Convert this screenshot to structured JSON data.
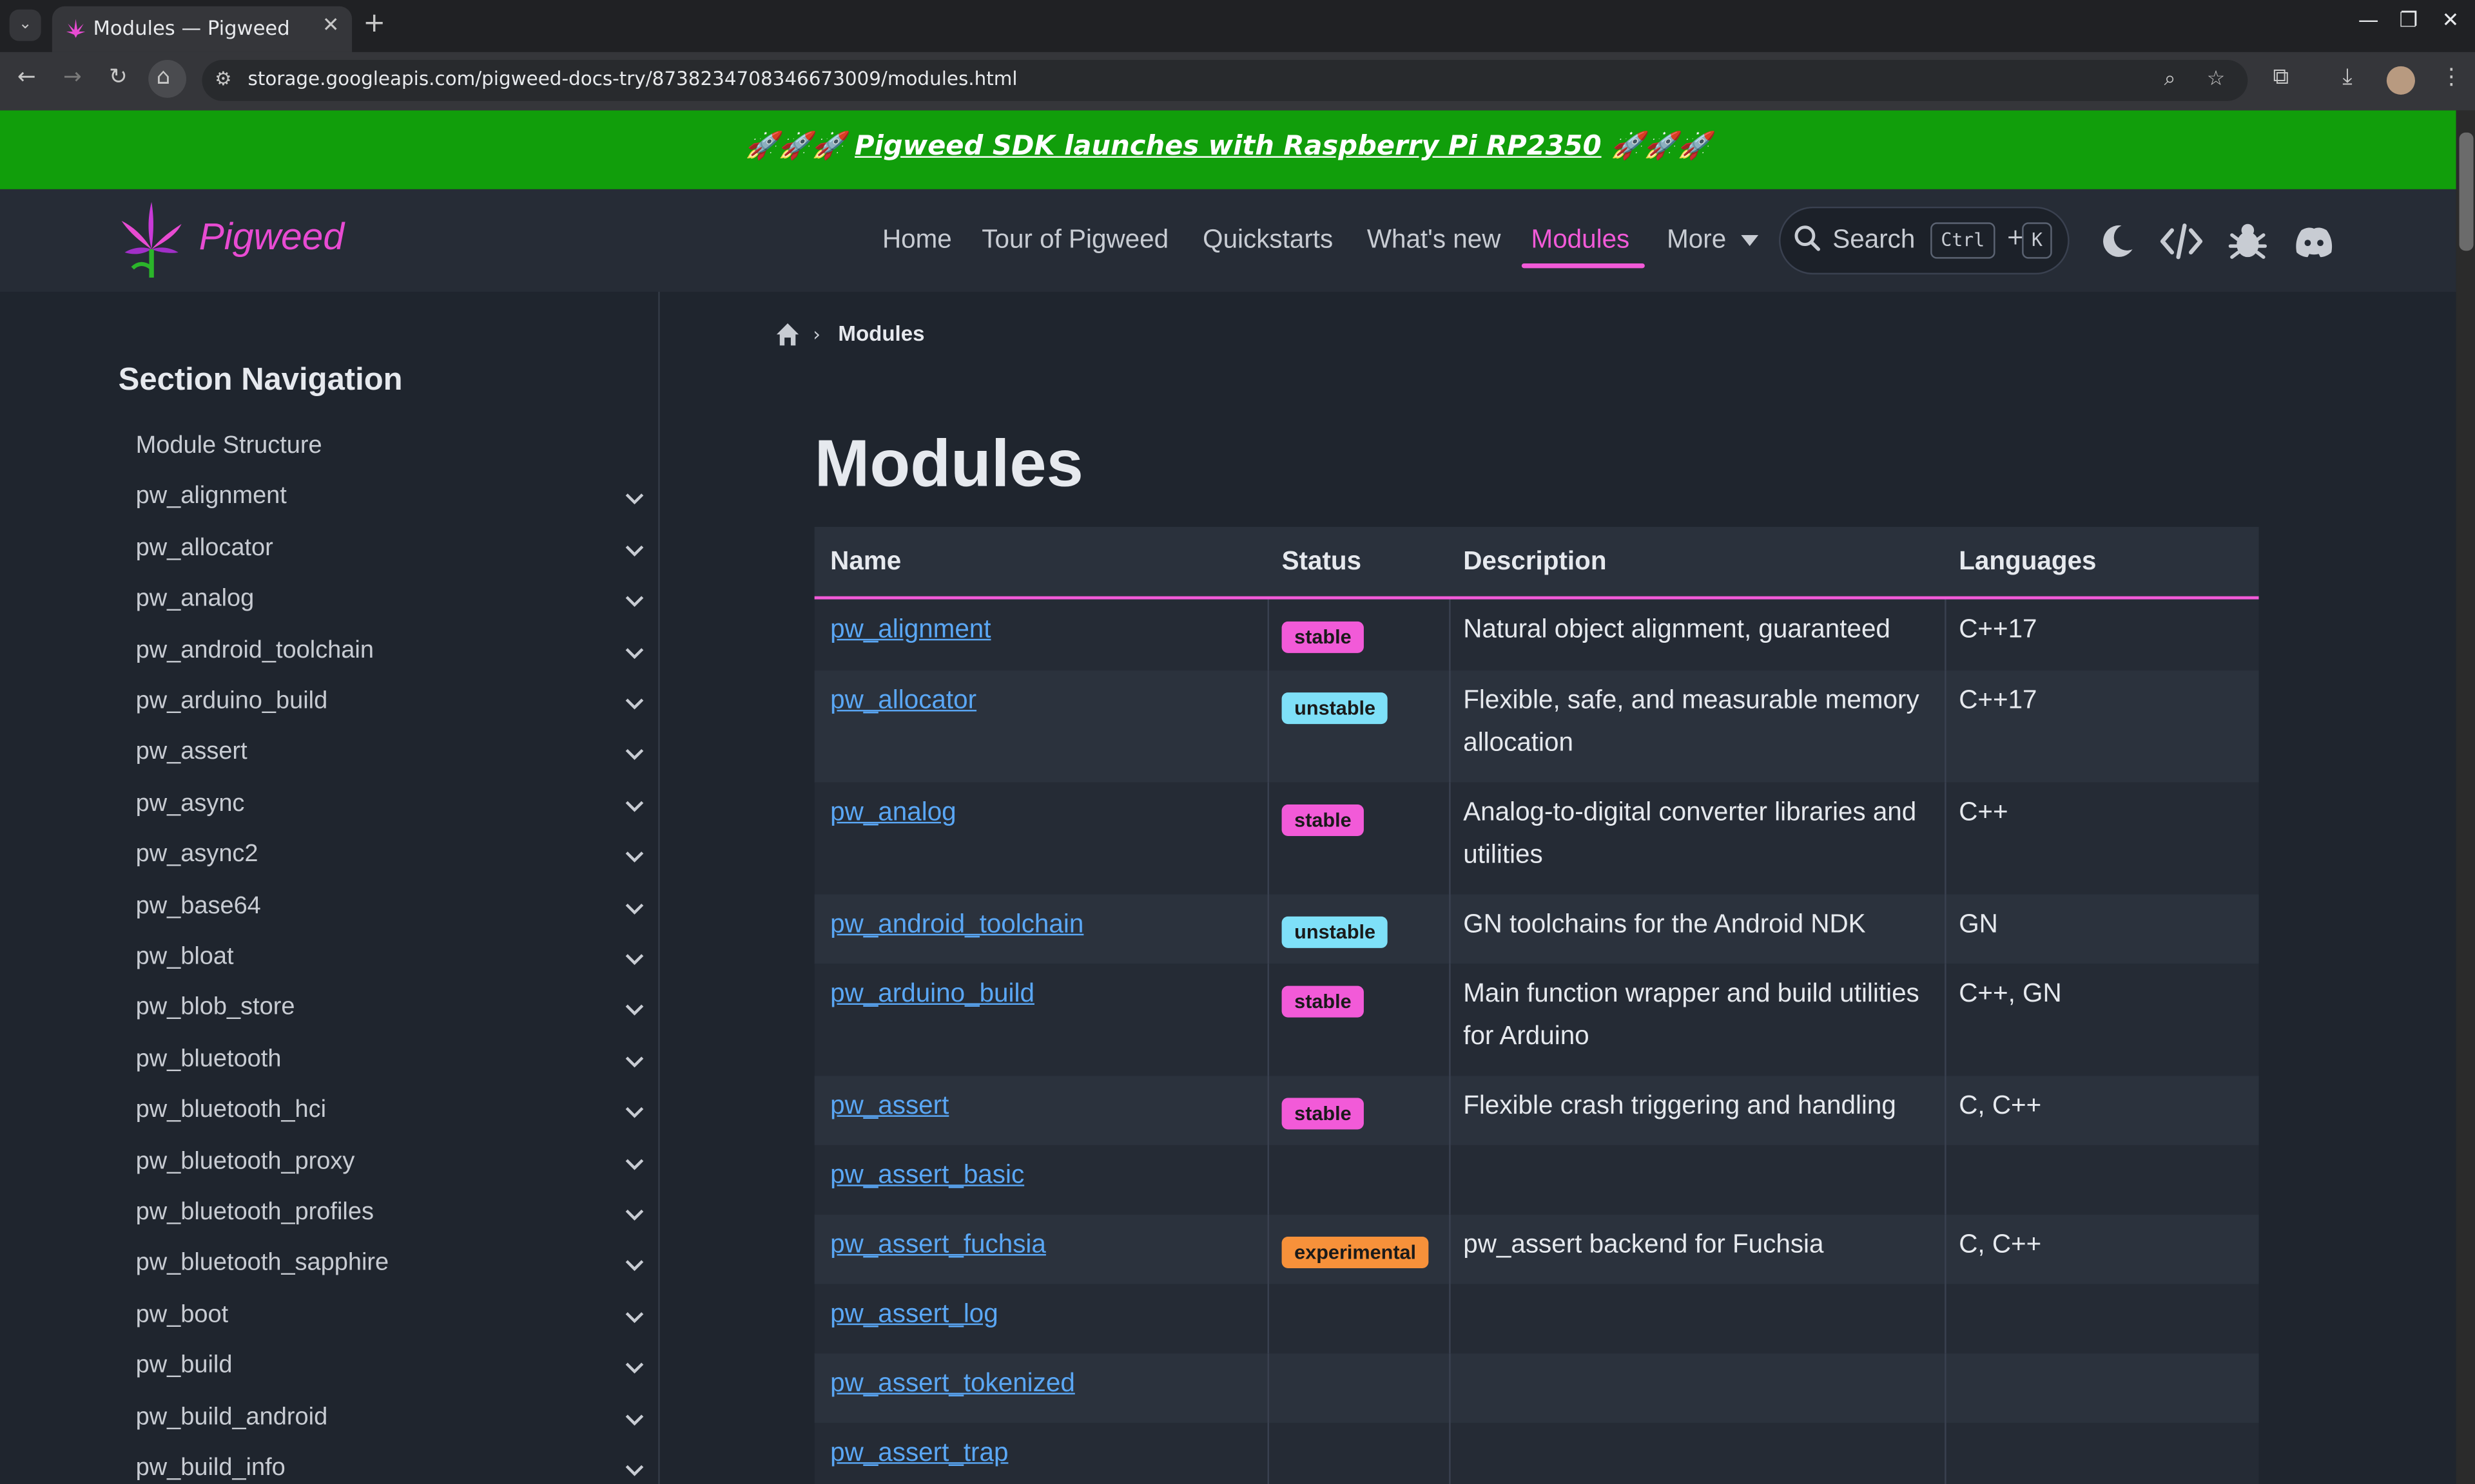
{
  "browser": {
    "tab_title": "Modules — Pigweed",
    "url": "storage.googleapis.com/pigweed-docs-try/8738234708346673009/modules.html",
    "tab_close": "✕",
    "new_tab": "+",
    "minimize": "—",
    "restore": "❐",
    "close": "✕",
    "back": "←",
    "forward": "→",
    "reload": "↻",
    "home": "⌂",
    "zoom": "⌕",
    "bookmark": "☆",
    "extensions": "⧉",
    "download": "⤓",
    "menu": "⋮",
    "site_info": "⚙",
    "tab_dropdown": "⌄"
  },
  "banner": {
    "prefix": "🚀🚀🚀 ",
    "link": "Pigweed SDK launches with Raspberry Pi RP2350",
    "suffix": " 🚀🚀🚀"
  },
  "header": {
    "logo_text": "Pigweed",
    "nav": [
      "Home",
      "Tour of Pigweed",
      "Quickstarts",
      "What's new",
      "Modules",
      "More"
    ],
    "search_label": "Search",
    "kbd_ctrl": "Ctrl",
    "kbd_plus": "+",
    "kbd_k": "K"
  },
  "sidebar": {
    "title": "Section Navigation",
    "items": [
      "Module Structure",
      "pw_alignment",
      "pw_allocator",
      "pw_analog",
      "pw_android_toolchain",
      "pw_arduino_build",
      "pw_assert",
      "pw_async",
      "pw_async2",
      "pw_base64",
      "pw_bloat",
      "pw_blob_store",
      "pw_bluetooth",
      "pw_bluetooth_hci",
      "pw_bluetooth_proxy",
      "pw_bluetooth_profiles",
      "pw_bluetooth_sapphire",
      "pw_boot",
      "pw_build",
      "pw_build_android",
      "pw_build_info"
    ]
  },
  "main": {
    "breadcrumb": "Modules",
    "breadcrumb_sep": "›",
    "title": "Modules",
    "columns": [
      "Name",
      "Status",
      "Description",
      "Languages"
    ],
    "rows": [
      {
        "name": "pw_alignment",
        "status": "stable",
        "desc": "Natural object alignment, guaranteed",
        "lang": "C++17"
      },
      {
        "name": "pw_allocator",
        "status": "unstable",
        "desc": "Flexible, safe, and measurable memory allocation",
        "lang": "C++17"
      },
      {
        "name": "pw_analog",
        "status": "stable",
        "desc": "Analog-to-digital converter libraries and utilities",
        "lang": "C++"
      },
      {
        "name": "pw_android_toolchain",
        "status": "unstable",
        "desc": "GN toolchains for the Android NDK",
        "lang": "GN"
      },
      {
        "name": "pw_arduino_build",
        "status": "stable",
        "desc": "Main function wrapper and build utilities for Arduino",
        "lang": "C++, GN"
      },
      {
        "name": "pw_assert",
        "status": "stable",
        "desc": "Flexible crash triggering and handling",
        "lang": "C, C++"
      },
      {
        "name": "pw_assert_basic",
        "status": "",
        "desc": "",
        "lang": ""
      },
      {
        "name": "pw_assert_fuchsia",
        "status": "experimental",
        "desc": "pw_assert backend for Fuchsia",
        "lang": "C, C++"
      },
      {
        "name": "pw_assert_log",
        "status": "",
        "desc": "",
        "lang": ""
      },
      {
        "name": "pw_assert_tokenized",
        "status": "",
        "desc": "",
        "lang": ""
      },
      {
        "name": "pw_assert_trap",
        "status": "",
        "desc": "",
        "lang": ""
      }
    ]
  },
  "colors": {
    "banner": "#119e0b",
    "accent": "#f25ad8",
    "link": "#5aa7f5",
    "unstable": "#7ee0f8",
    "experimental": "#f7913a"
  }
}
